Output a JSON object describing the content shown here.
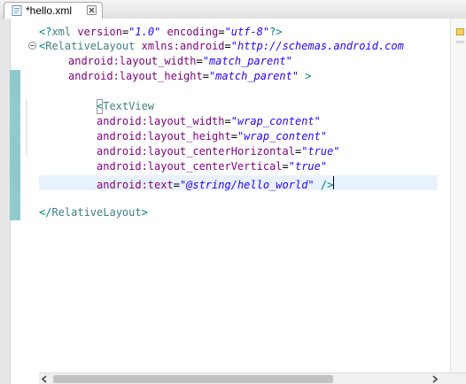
{
  "tab": {
    "label": "*hello.xml",
    "file_icon": "xml-file-icon",
    "close_icon": "close-icon"
  },
  "editor": {
    "lines": {
      "l1": {
        "open": "<?",
        "tag": "xml",
        "a1": " version",
        "eq1": "=",
        "v1": "\"1.0\"",
        "a2": " encoding",
        "eq2": "=",
        "v2": "\"utf-8\"",
        "close": "?>"
      },
      "l2": {
        "open": "<",
        "tag": "RelativeLayout",
        "a1": " xmlns:android",
        "eq1": "=",
        "v1": "\"http://schemas.android.com"
      },
      "l3": {
        "a1": "android:layout_width",
        "eq1": "=",
        "v1": "\"match_parent\""
      },
      "l4": {
        "a1": "android:layout_height",
        "eq1": "=",
        "v1": "\"match_parent\"",
        "close": " >"
      },
      "l6": {
        "open": "<",
        "tag": "TextView"
      },
      "l7": {
        "a1": "android:layout_width",
        "eq1": "=",
        "v1": "\"wrap_content\""
      },
      "l8": {
        "a1": "android:layout_height",
        "eq1": "=",
        "v1": "\"wrap_content\""
      },
      "l9": {
        "a1": "android:layout_centerHorizontal",
        "eq1": "=",
        "v1": "\"true\""
      },
      "l10": {
        "a1": "android:layout_centerVertical",
        "eq1": "=",
        "v1": "\"true\""
      },
      "l11": {
        "a1": "android:text",
        "eq1": "=",
        "v1": "\"@string/hello_world\"",
        "close": " />"
      },
      "l13": {
        "open": "</",
        "tag": "RelativeLayout",
        "close": ">"
      }
    }
  },
  "colors": {
    "tag": "#3f7f7f",
    "attribute": "#7f007f",
    "value": "#2a00ff",
    "bracket": "#008080",
    "current_line": "#e8f2fe"
  }
}
